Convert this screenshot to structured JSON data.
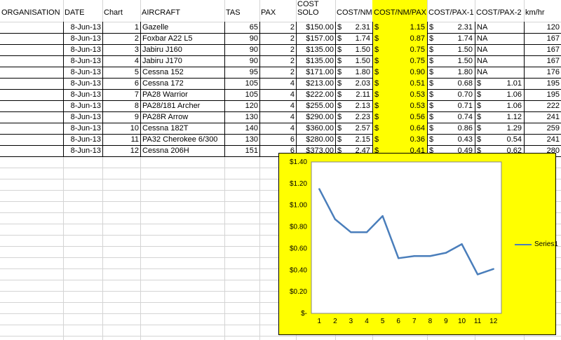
{
  "columns": {
    "organisation": "ORGANISATION",
    "date": "DATE",
    "chart": "Chart",
    "aircraft": "AIRCRAFT",
    "tas": "TAS",
    "pax": "PAX",
    "cost_solo_line1": "COST",
    "cost_solo_line2": "SOLO",
    "cost_nm": "COST/NM",
    "cost_nm_pax": "COST/NM/PAX",
    "cost_pax_1": "COST/PAX-1",
    "cost_pax_2": "COST/PAX-2",
    "kmhr": "km/hr"
  },
  "rows": [
    {
      "organisation": "",
      "date": "8-Jun-13",
      "chart": "1",
      "aircraft": "Gazelle",
      "tas": "65",
      "pax": "2",
      "cost_solo": "$150.00",
      "cost_nm": "2.31",
      "cost_nm_pax": "1.15",
      "cost_pax_1": "2.31",
      "cost_pax_2": "NA",
      "kmhr": "120"
    },
    {
      "organisation": "",
      "date": "8-Jun-13",
      "chart": "2",
      "aircraft": "Foxbar A22 L5",
      "tas": "90",
      "pax": "2",
      "cost_solo": "$157.00",
      "cost_nm": "1.74",
      "cost_nm_pax": "0.87",
      "cost_pax_1": "1.74",
      "cost_pax_2": "NA",
      "kmhr": "167"
    },
    {
      "organisation": "",
      "date": "8-Jun-13",
      "chart": "3",
      "aircraft": "Jabiru J160",
      "tas": "90",
      "pax": "2",
      "cost_solo": "$135.00",
      "cost_nm": "1.50",
      "cost_nm_pax": "0.75",
      "cost_pax_1": "1.50",
      "cost_pax_2": "NA",
      "kmhr": "167"
    },
    {
      "organisation": "",
      "date": "8-Jun-13",
      "chart": "4",
      "aircraft": "Jabiru J170",
      "tas": "90",
      "pax": "2",
      "cost_solo": "$135.00",
      "cost_nm": "1.50",
      "cost_nm_pax": "0.75",
      "cost_pax_1": "1.50",
      "cost_pax_2": "NA",
      "kmhr": "167"
    },
    {
      "organisation": "",
      "date": "8-Jun-13",
      "chart": "5",
      "aircraft": "Cessna 152",
      "tas": "95",
      "pax": "2",
      "cost_solo": "$171.00",
      "cost_nm": "1.80",
      "cost_nm_pax": "0.90",
      "cost_pax_1": "1.80",
      "cost_pax_2": "NA",
      "kmhr": "176"
    },
    {
      "organisation": "",
      "date": "8-Jun-13",
      "chart": "6",
      "aircraft": "Cessna 172",
      "tas": "105",
      "pax": "4",
      "cost_solo": "$213.00",
      "cost_nm": "2.03",
      "cost_nm_pax": "0.51",
      "cost_pax_1": "0.68",
      "cost_pax_2": "1.01",
      "kmhr": "195"
    },
    {
      "organisation": "",
      "date": "8-Jun-13",
      "chart": "7",
      "aircraft": "PA28 Warrior",
      "tas": "105",
      "pax": "4",
      "cost_solo": "$222.00",
      "cost_nm": "2.11",
      "cost_nm_pax": "0.53",
      "cost_pax_1": "0.70",
      "cost_pax_2": "1.06",
      "kmhr": "195"
    },
    {
      "organisation": "",
      "date": "8-Jun-13",
      "chart": "8",
      "aircraft": "PA28/181 Archer",
      "tas": "120",
      "pax": "4",
      "cost_solo": "$255.00",
      "cost_nm": "2.13",
      "cost_nm_pax": "0.53",
      "cost_pax_1": "0.71",
      "cost_pax_2": "1.06",
      "kmhr": "222"
    },
    {
      "organisation": "",
      "date": "8-Jun-13",
      "chart": "9",
      "aircraft": "PA28R Arrow",
      "tas": "130",
      "pax": "4",
      "cost_solo": "$290.00",
      "cost_nm": "2.23",
      "cost_nm_pax": "0.56",
      "cost_pax_1": "0.74",
      "cost_pax_2": "1.12",
      "kmhr": "241"
    },
    {
      "organisation": "",
      "date": "8-Jun-13",
      "chart": "10",
      "aircraft": "Cessna 182T",
      "tas": "140",
      "pax": "4",
      "cost_solo": "$360.00",
      "cost_nm": "2.57",
      "cost_nm_pax": "0.64",
      "cost_pax_1": "0.86",
      "cost_pax_2": "1.29",
      "kmhr": "259"
    },
    {
      "organisation": "",
      "date": "8-Jun-13",
      "chart": "11",
      "aircraft": "PA32 Cherokee 6/300",
      "tas": "130",
      "pax": "6",
      "cost_solo": "$280.00",
      "cost_nm": "2.15",
      "cost_nm_pax": "0.36",
      "cost_pax_1": "0.43",
      "cost_pax_2": "0.54",
      "kmhr": "241"
    },
    {
      "organisation": "",
      "date": "8-Jun-13",
      "chart": "12",
      "aircraft": "Cessna 206H",
      "tas": "151",
      "pax": "6",
      "cost_solo": "$373.00",
      "cost_nm": "2.47",
      "cost_nm_pax": "0.41",
      "cost_pax_1": "0.49",
      "cost_pax_2": "0.62",
      "kmhr": "280"
    }
  ],
  "currency_symbol": "$",
  "colors": {
    "highlight": "#ffff00",
    "series": "#4a7ebb",
    "grid": "#d4d4d4"
  },
  "chart_data": {
    "type": "line",
    "x": [
      1,
      2,
      3,
      4,
      5,
      6,
      7,
      8,
      9,
      10,
      11,
      12
    ],
    "series": [
      {
        "name": "Series1",
        "values": [
          1.15,
          0.87,
          0.75,
          0.75,
          0.9,
          0.51,
          0.53,
          0.53,
          0.56,
          0.64,
          0.36,
          0.41
        ]
      }
    ],
    "y_tick_labels": [
      "$-",
      "$0.20",
      "$0.40",
      "$0.60",
      "$0.80",
      "$1.00",
      "$1.20",
      "$1.40"
    ],
    "ylim": [
      0,
      1.4
    ],
    "title": "",
    "xlabel": "",
    "ylabel": "",
    "grid": false,
    "legend": "right"
  }
}
